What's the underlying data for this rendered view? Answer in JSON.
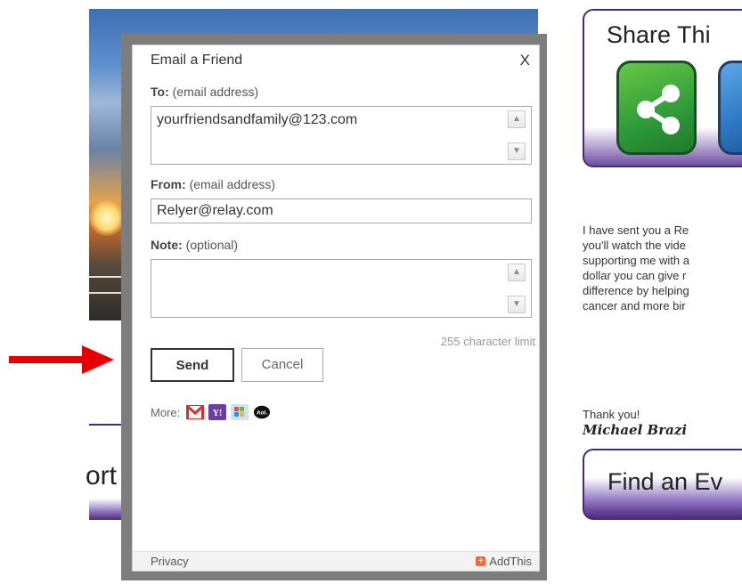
{
  "background": {
    "sport_text": "ort",
    "share": {
      "title": "Share Thi"
    },
    "letter": {
      "lines": [
        "I have sent you a Re",
        "you'll watch the vide",
        "supporting me with a",
        "dollar you can give r",
        "difference by helping",
        "cancer and more bir"
      ],
      "thanks": "Thank you!",
      "signature": "Michael Brazi"
    },
    "find_event": {
      "label": "Find an Ev"
    }
  },
  "modal": {
    "title": "Email a Friend",
    "close": "X",
    "to": {
      "label": "To:",
      "hint": "(email address)",
      "value": "yourfriendsandfamily@123.com"
    },
    "from": {
      "label": "From:",
      "hint": "(email address)",
      "value": "Relyer@relay.com"
    },
    "note": {
      "label": "Note:",
      "hint": "(optional)",
      "value": ""
    },
    "char_limit": "255 character limit",
    "send_label": "Send",
    "cancel_label": "Cancel",
    "more_label": "More:",
    "services": [
      "gmail-icon",
      "yahoo-icon",
      "windows-live-icon",
      "aol-icon"
    ],
    "footer": {
      "privacy": "Privacy",
      "brand": "AddThis"
    }
  },
  "colors": {
    "accent_purple": "#4b2a7b",
    "arrow_red": "#e60000",
    "addthis_orange": "#f2693c"
  }
}
